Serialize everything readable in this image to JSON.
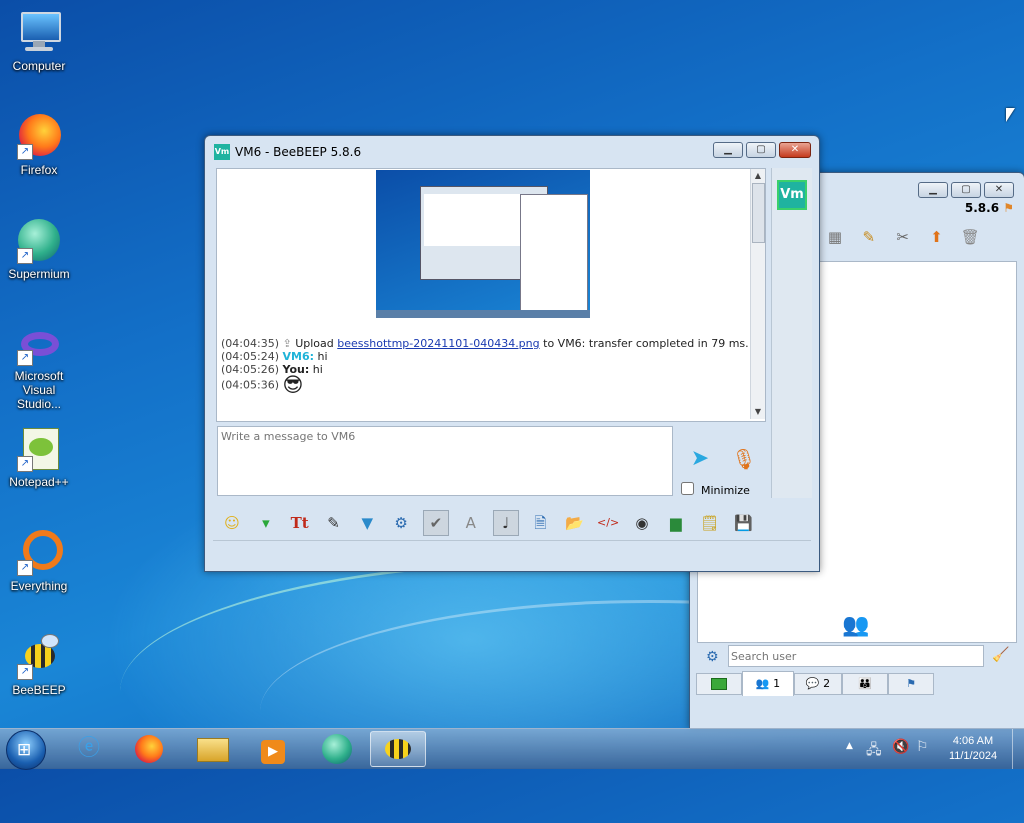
{
  "desktop": {
    "icons": [
      {
        "label": "Computer"
      },
      {
        "label": "Firefox"
      },
      {
        "label": "Supermium"
      },
      {
        "label": "Microsoft Visual Studio..."
      },
      {
        "label": "Notepad++"
      },
      {
        "label": "Everything"
      },
      {
        "label": "BeeBEEP"
      }
    ]
  },
  "chat_window": {
    "title": "VM6 - BeeBEEP 5.8.6",
    "avatar_text": "Vm",
    "messages": [
      {
        "time": "(04:04:35)",
        "prefix": "Upload",
        "link": "beesshottmp-20241101-040434.png",
        "suffix": "to VM6: transfer completed in 79 ms."
      },
      {
        "time": "(04:05:24)",
        "sender": "VM6:",
        "text": "hi"
      },
      {
        "time": "(04:05:26)",
        "sender": "You:",
        "text": "hi"
      },
      {
        "time": "(04:05:36)",
        "emoji": "😎"
      }
    ],
    "input_placeholder": "Write a message to VM6",
    "minimize_label": "Minimize"
  },
  "main_window": {
    "version": "5.8.6",
    "search_placeholder": "Search user",
    "tabs": [
      {
        "label": ""
      },
      {
        "label": "1"
      },
      {
        "label": "2"
      },
      {
        "label": ""
      },
      {
        "label": ""
      }
    ]
  },
  "taskbar": {
    "time": "4:06 AM",
    "date": "11/1/2024"
  }
}
